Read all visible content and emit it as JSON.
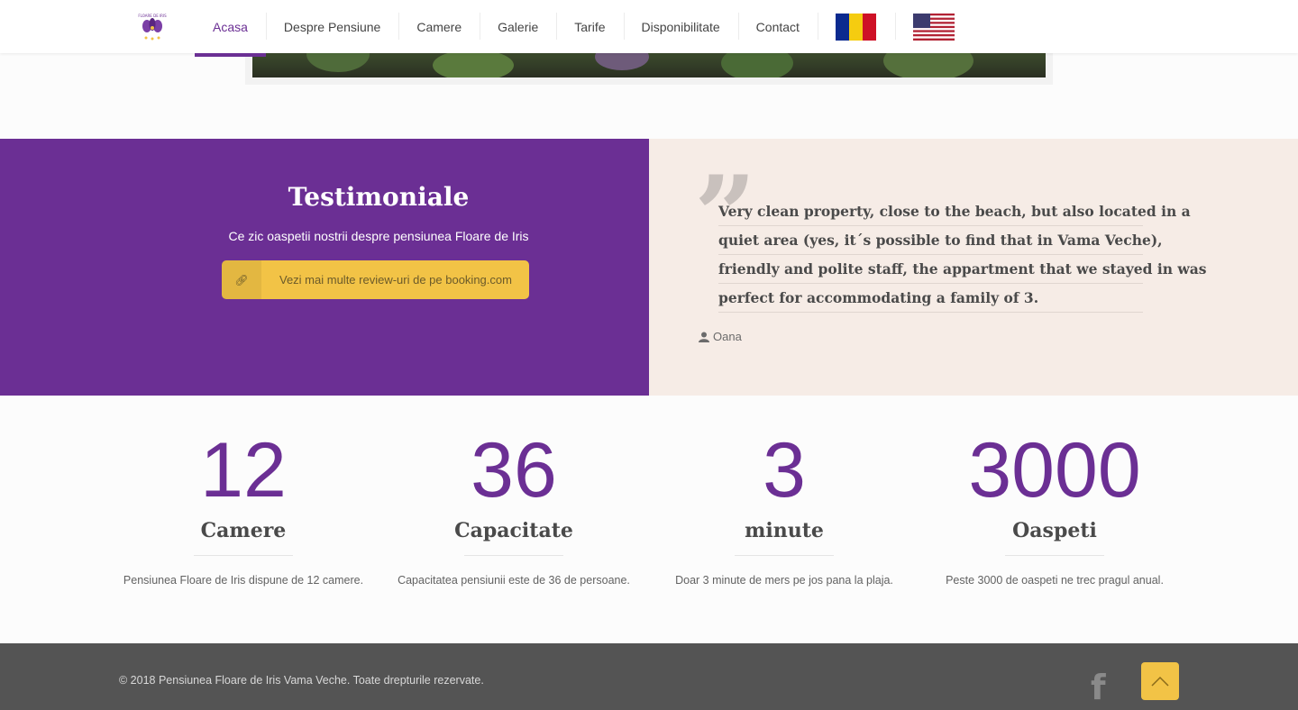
{
  "nav": {
    "items": [
      {
        "label": "Acasa",
        "active": true
      },
      {
        "label": "Despre Pensiune"
      },
      {
        "label": "Camere"
      },
      {
        "label": "Galerie"
      },
      {
        "label": "Tarife"
      },
      {
        "label": "Disponibilitate"
      },
      {
        "label": "Contact"
      }
    ]
  },
  "testimonials": {
    "title": "Testimoniale",
    "subtitle": "Ce zic oaspetii nostrii despre pensiunea Floare de Iris",
    "button_label": "Vezi mai multe review-uri de pe booking.com",
    "quote_lines": [
      "Very clean property, close to the beach, but also located in a",
      "quiet area (yes, it´s possible to find that in Vama Veche),",
      "friendly and polite staff, the appartment that we stayed in was",
      "perfect for accommodating a family of 3."
    ],
    "author": "Oana"
  },
  "counters": [
    {
      "number": "12",
      "title": "Camere",
      "desc": "Pensiunea Floare de Iris dispune de 12 camere."
    },
    {
      "number": "36",
      "title": "Capacitate",
      "desc": "Capacitatea pensiunii este de 36 de persoane."
    },
    {
      "number": "3",
      "title": "minute",
      "desc": "Doar 3 minute de mers pe jos pana la plaja."
    },
    {
      "number": "3000",
      "title": "Oaspeti",
      "desc": "Peste 3000 de oaspeti ne trec pragul anual."
    }
  ],
  "footer": {
    "copyright": "© 2018 Pensiunea Floare de Iris Vama Veche. Toate drepturile rezervate."
  },
  "colors": {
    "brand_purple": "#6b2f94",
    "accent_yellow": "#f2c346",
    "testimonial_bg": "#f6ece6",
    "footer_bg": "#545454"
  },
  "icons": [
    "iris-logo",
    "romania-flag-icon",
    "usa-flag-icon",
    "link-icon",
    "quote-icon",
    "user-icon",
    "facebook-icon",
    "arrow-up-icon"
  ]
}
